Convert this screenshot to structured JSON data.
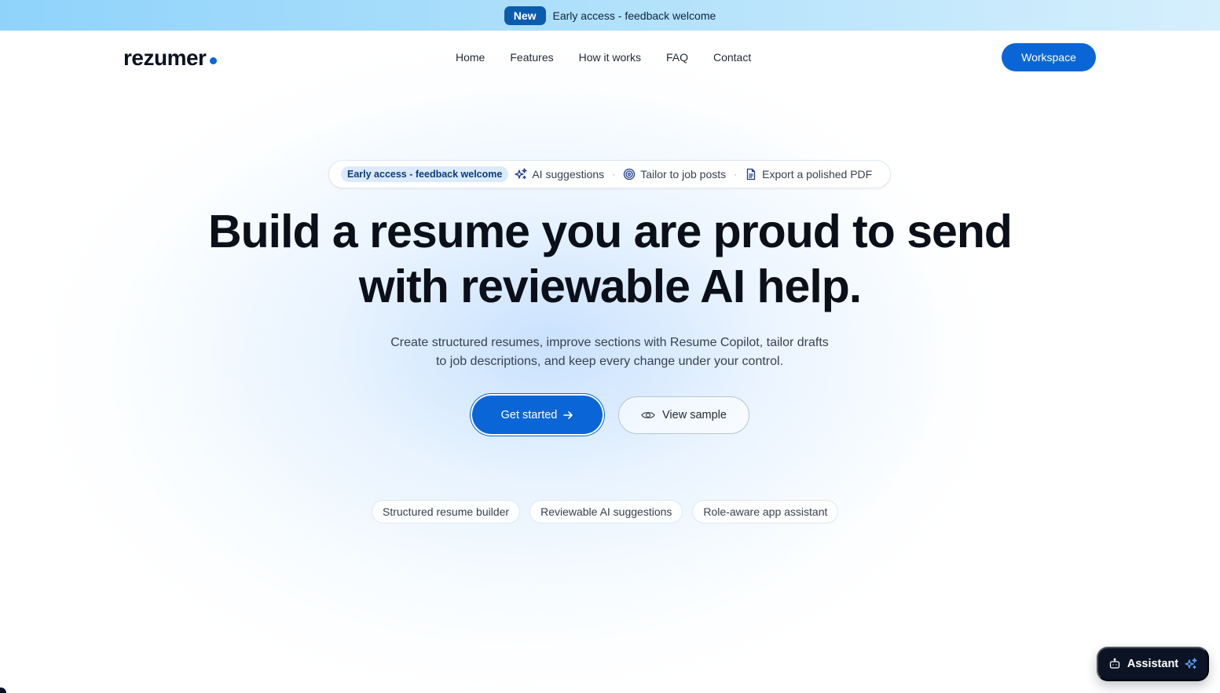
{
  "announcement": {
    "badge": "New",
    "text": "Early access - feedback welcome"
  },
  "header": {
    "logo_text": "rezumer",
    "nav": [
      {
        "label": "Home"
      },
      {
        "label": "Features"
      },
      {
        "label": "How it works"
      },
      {
        "label": "FAQ"
      },
      {
        "label": "Contact"
      }
    ],
    "workspace_label": "Workspace"
  },
  "feature_pill": {
    "chip": "Early access - feedback welcome",
    "items": [
      {
        "label": "AI suggestions",
        "icon": "sparkles-icon"
      },
      {
        "label": "Tailor to job posts",
        "icon": "target-icon"
      },
      {
        "label": "Export a polished PDF",
        "icon": "document-icon"
      }
    ],
    "separator": "·"
  },
  "hero": {
    "title_line1": "Build a resume you are proud to send",
    "title_line2": "with reviewable AI help.",
    "subtitle_line1": "Create structured resumes, improve sections with Resume Copilot, tailor drafts",
    "subtitle_line2": "to job descriptions, and keep every change under your control.",
    "primary_cta": "Get started",
    "secondary_cta": "View sample"
  },
  "tags": [
    {
      "label": "Structured resume builder"
    },
    {
      "label": "Reviewable AI suggestions"
    },
    {
      "label": "Role-aware app assistant"
    }
  ],
  "assistant": {
    "label": "Assistant"
  },
  "colors": {
    "brand": "#0a66d6",
    "announcement_badge": "#0b5cad",
    "dark": "#0b1324"
  }
}
